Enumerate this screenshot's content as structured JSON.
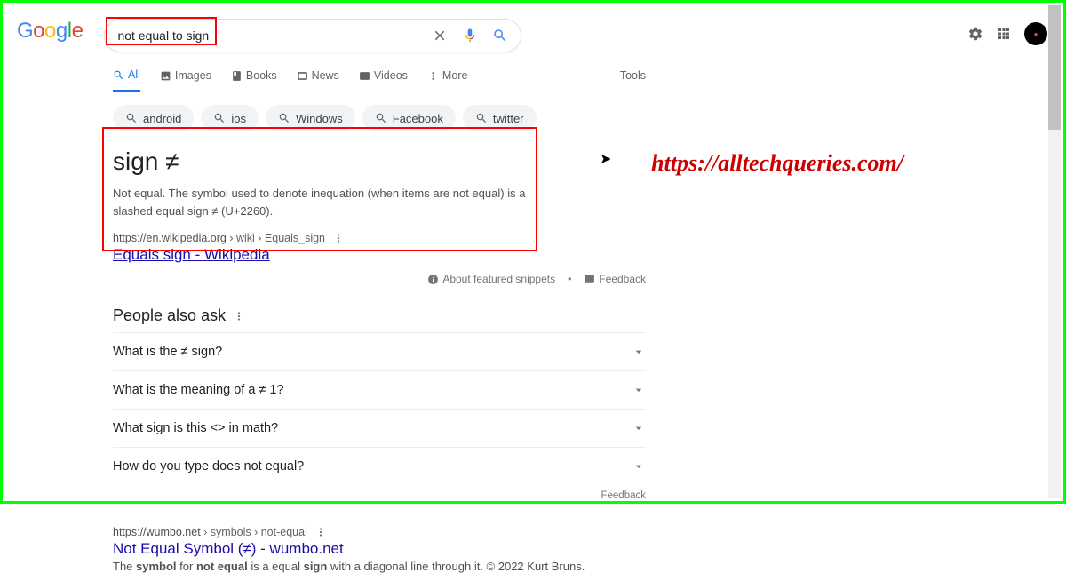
{
  "logo_letters": [
    "G",
    "o",
    "o",
    "g",
    "l",
    "e"
  ],
  "search": {
    "query": "not equal to sign"
  },
  "tabs": {
    "all": "All",
    "images": "Images",
    "books": "Books",
    "news": "News",
    "videos": "Videos",
    "more": "More",
    "tools": "Tools"
  },
  "chips": {
    "android": "android",
    "ios": "ios",
    "windows": "Windows",
    "facebook": "Facebook",
    "twitter": "twitter"
  },
  "featured": {
    "heading": "sign ≠",
    "body": "Not equal. The symbol used to denote inequation (when items are not equal) is a slashed equal sign ≠ (U+2260).",
    "url": "https://en.wikipedia.org",
    "path": " › wiki › Equals_sign",
    "title": "Equals sign - Wikipedia",
    "about": "About featured snippets",
    "feedback": "Feedback"
  },
  "paa": {
    "title": "People also ask",
    "q1": "What is the ≠ sign?",
    "q2": "What is the meaning of a ≠ 1?",
    "q3": "What sign is this <> in math?",
    "q4": "How do you type does not equal?",
    "feedback": "Feedback"
  },
  "result2": {
    "url": "https://wumbo.net",
    "path": " › symbols › not-equal",
    "title": "Not Equal Symbol (≠) - wumbo.net",
    "desc_pre": "The ",
    "desc_b1": "symbol",
    "desc_mid1": " for ",
    "desc_b2": "not equal",
    "desc_mid2": " is a equal ",
    "desc_b3": "sign",
    "desc_post": " with a diagonal line through it. © 2022 Kurt Bruns."
  },
  "watermark": "https://alltechqueries.com/"
}
